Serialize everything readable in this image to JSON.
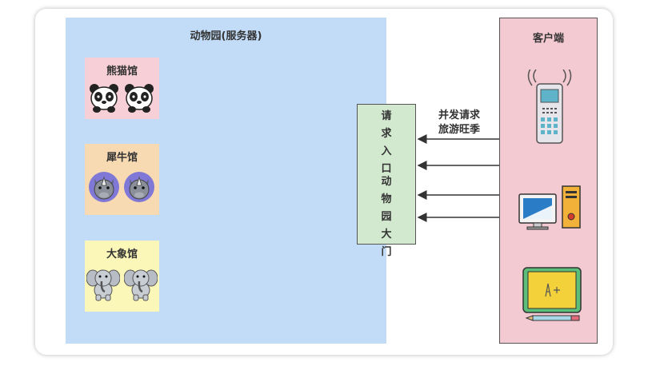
{
  "server": {
    "title": "动物园(服务器)"
  },
  "halls": [
    {
      "name": "熊猫馆",
      "animal": "panda-icon",
      "color": "#f7cfd6"
    },
    {
      "name": "犀牛馆",
      "animal": "rhino-icon",
      "color": "#f8dab2"
    },
    {
      "name": "大象馆",
      "animal": "elephant-icon",
      "color": "#fbf7b8"
    }
  ],
  "gate": {
    "top": "请求入口",
    "bottom": "动物园大门"
  },
  "client": {
    "title": "客户端",
    "devices": [
      "mobile-phone-icon",
      "desktop-computer-icon",
      "tablet-icon"
    ]
  },
  "request_label": {
    "line1": "并发请求",
    "line2": "旅游旺季"
  },
  "colors": {
    "server": "#c2dcf7",
    "gate": "#d2e8cf",
    "client": "#f3c9d2"
  }
}
